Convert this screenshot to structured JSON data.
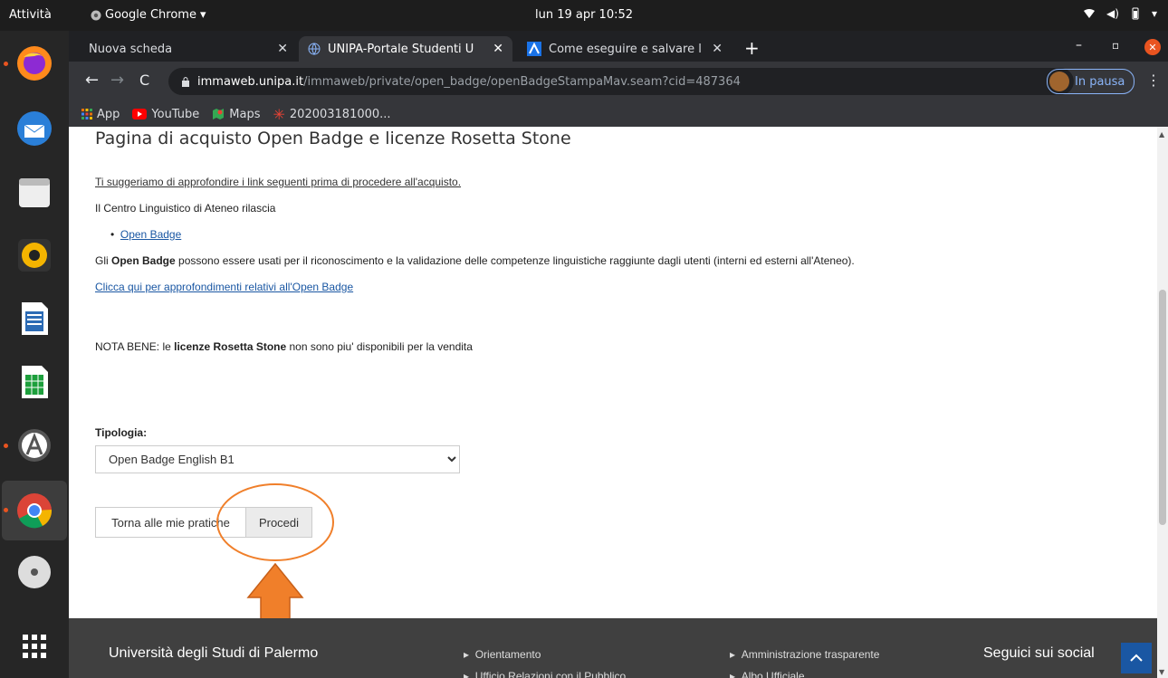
{
  "topbar": {
    "activities": "Attività",
    "app_menu": "Google Chrome",
    "clock": "lun 19 apr  10:52"
  },
  "chrome": {
    "tabs": [
      {
        "title": "Nuova scheda"
      },
      {
        "title": "UNIPA-Portale Studenti U"
      },
      {
        "title": "Come eseguire e salvare l"
      }
    ],
    "omnibox": {
      "host": "immaweb.unipa.it",
      "path": "/immaweb/private/open_badge/openBadgeStampaMav.seam?cid=487364"
    },
    "profile_label": "In pausa",
    "bookmarks": [
      {
        "label": "App",
        "icon": "apps-grid-icon"
      },
      {
        "label": "YouTube",
        "icon": "youtube-icon"
      },
      {
        "label": "Maps",
        "icon": "maps-icon"
      },
      {
        "label": "202003181000...",
        "icon": "asterisk-icon"
      }
    ]
  },
  "page": {
    "title": "Pagina di acquisto Open Badge e licenze Rosetta Stone",
    "suggest_link": "Ti suggeriamo di approfondire i link seguenti prima di procedere all'acquisto.",
    "centro_text": "Il Centro Linguistico di Ateneo rilascia",
    "bullet_link": "Open Badge",
    "desc_prefix": "Gli ",
    "desc_bold": "Open Badge",
    "desc_rest": " possono essere usati per il riconoscimento e la validazione delle competenze linguistiche raggiunte dagli utenti (interni ed esterni all'Ateneo).",
    "info_link": "Clicca qui per approfondimenti relativi all'Open Badge",
    "nota_prefix": "NOTA BENE: le ",
    "nota_bold": "licenze Rosetta Stone",
    "nota_rest": " non sono piu' disponibili per la vendita",
    "tipologia_label": "Tipologia:",
    "tipologia_selected": "Open Badge English B1",
    "back_button": "Torna alle mie pratiche",
    "proceed_button": "Procedi"
  },
  "footer": {
    "university": "Università degli Studi di Palermo",
    "col1": [
      "Orientamento",
      "Ufficio Relazioni con il Pubblico"
    ],
    "col2": [
      "Amministrazione trasparente",
      "Albo Ufficiale"
    ],
    "social": "Seguici sui social"
  },
  "annotation": {
    "highlight_color": "#f07f2a",
    "target": "Procedi"
  },
  "colors": {
    "dock_bg": "#262626",
    "topbar_bg": "#1d1d1d",
    "chrome_dark": "#35363a",
    "footer_bg": "#404040",
    "link_blue": "#1a57a3"
  }
}
